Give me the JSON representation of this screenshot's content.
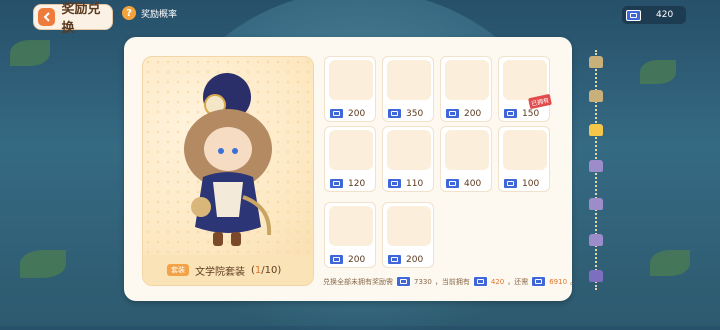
{
  "header": {
    "back_label": "奖励兑换",
    "probability_label": "奖励概率",
    "currency_value": "420"
  },
  "preview": {
    "badge": "套装",
    "set_name": "文学院套装",
    "progress_owned": "1",
    "progress_total": "10"
  },
  "items": [
    {
      "price": "200",
      "tag": ""
    },
    {
      "price": "350",
      "tag": ""
    },
    {
      "price": "200",
      "tag": ""
    },
    {
      "price": "150",
      "tag": "已拥有"
    },
    {
      "price": "120",
      "tag": ""
    },
    {
      "price": "110",
      "tag": ""
    },
    {
      "price": "400",
      "tag": ""
    },
    {
      "price": "100",
      "tag": ""
    },
    {
      "price": "200",
      "tag": ""
    },
    {
      "price": "200",
      "tag": ""
    }
  ],
  "footer": {
    "text_a": "兑换全部未拥有奖励需",
    "needed": "7330",
    "text_b": "，当前拥有",
    "owned": "420",
    "text_c": "，还需",
    "remaining": "6910",
    "text_d": "。"
  },
  "colors": {
    "accent": "#ee7b3c",
    "highlight": "#e2762d",
    "ticket": "#3f67d8"
  },
  "track_icons": [
    "shirt-icon",
    "shirt-icon",
    "shirt-icon",
    "hat-icon",
    "shirt-icon",
    "shirt-icon",
    "shirt-icon",
    "crown-icon"
  ]
}
